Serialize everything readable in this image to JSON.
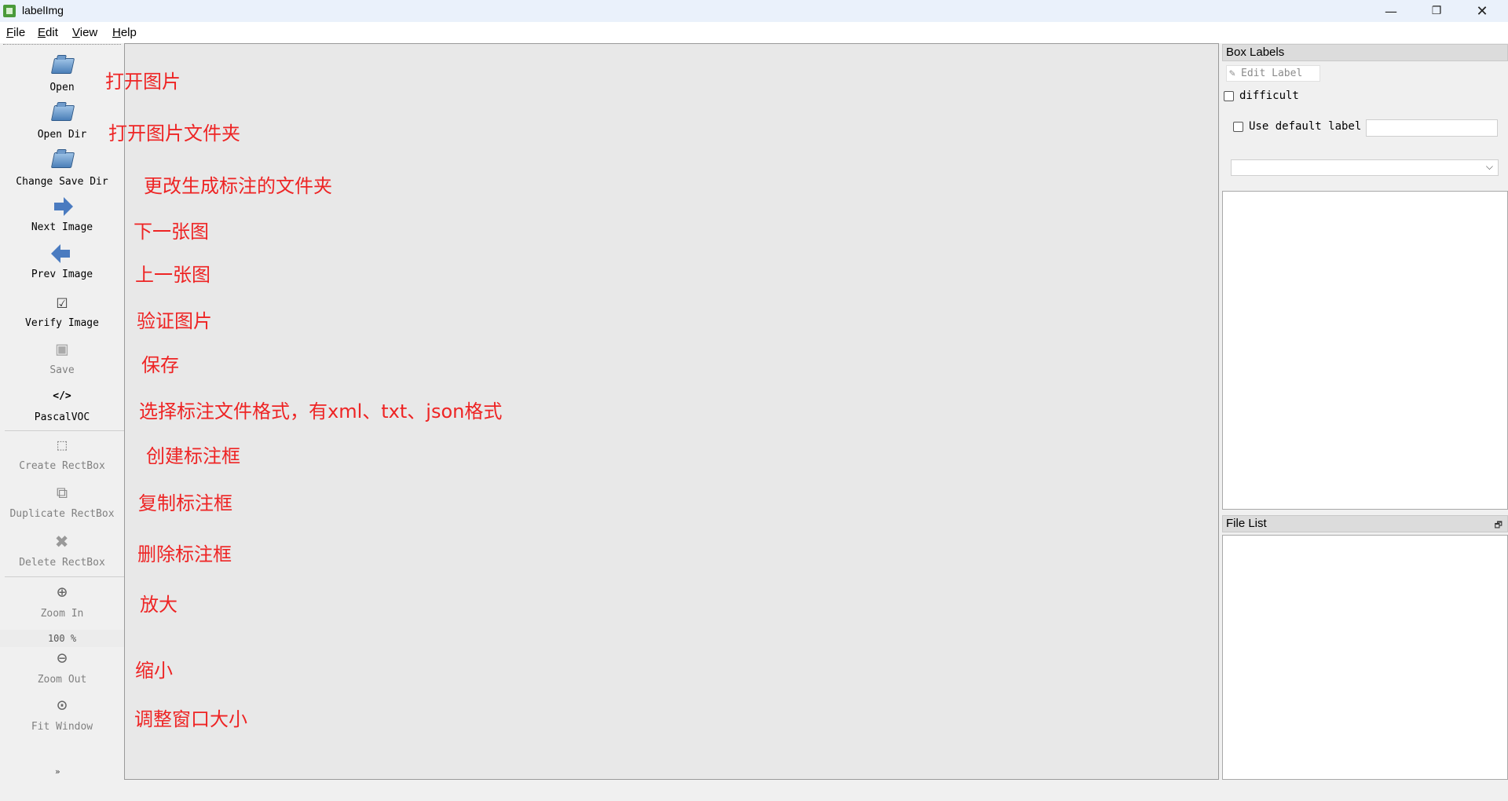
{
  "window": {
    "title": "labelImg",
    "icon": "labelimg-app-icon",
    "controls": {
      "minimize": "—",
      "maximize": "❐",
      "close": "✕"
    }
  },
  "menu": {
    "file": "File",
    "edit": "Edit",
    "view": "View",
    "help": "Help"
  },
  "toolbar": {
    "open": {
      "label": "Open",
      "icon": "open-folder-icon"
    },
    "open_dir": {
      "label": "Open Dir",
      "icon": "open-folder-icon"
    },
    "change_save_dir": {
      "label": "Change Save Dir",
      "icon": "open-folder-icon"
    },
    "next_image": {
      "label": "Next Image",
      "icon": "arrow-right-icon"
    },
    "prev_image": {
      "label": "Prev Image",
      "icon": "arrow-left-icon"
    },
    "verify_image": {
      "label": "Verify Image",
      "icon": "checkbox-icon"
    },
    "save": {
      "label": "Save",
      "icon": "save-icon",
      "disabled": true
    },
    "format": {
      "label": "PascalVOC",
      "icon": "code-icon",
      "glyph": "</>"
    },
    "create_rectbox": {
      "label": "Create RectBox",
      "icon": "create-rect-icon",
      "disabled": true
    },
    "duplicate_rectbox": {
      "label": "Duplicate RectBox",
      "icon": "duplicate-icon",
      "disabled": true
    },
    "delete_rectbox": {
      "label": "Delete RectBox",
      "icon": "delete-x-icon",
      "disabled": true
    },
    "zoom_in": {
      "label": "Zoom In",
      "icon": "zoom-in-icon",
      "disabled": true
    },
    "zoom_value": "100 %",
    "zoom_out": {
      "label": "Zoom Out",
      "icon": "zoom-out-icon",
      "disabled": true
    },
    "fit_window": {
      "label": "Fit Window",
      "icon": "fit-window-icon",
      "disabled": true
    },
    "more": "»"
  },
  "annotations": {
    "open": "打开图片",
    "open_dir": "打开图片文件夹",
    "change_save_dir": "更改生成标注的文件夹",
    "next_image": "下一张图",
    "prev_image": "上一张图",
    "verify_image": "验证图片",
    "save": "保存",
    "format": "选择标注文件格式，有xml、txt、json格式",
    "create_rectbox": "创建标注框",
    "duplicate_rectbox": "复制标注框",
    "delete_rectbox": "删除标注框",
    "zoom_in": "放大",
    "zoom_out": "缩小",
    "fit_window": "调整窗口大小"
  },
  "colors": {
    "annotation_text": "#ee2424",
    "canvas": "#e8e8e8",
    "titlebar": "#eaf1fb"
  },
  "box_labels": {
    "title": "Box Labels",
    "edit_label_button": "Edit Label",
    "difficult_label": "difficult",
    "difficult_checked": false,
    "use_default_label": "Use default label",
    "use_default_checked": false,
    "default_label_value": "",
    "combo_value": ""
  },
  "file_list": {
    "title": "File List",
    "float_icon": "🗗"
  }
}
